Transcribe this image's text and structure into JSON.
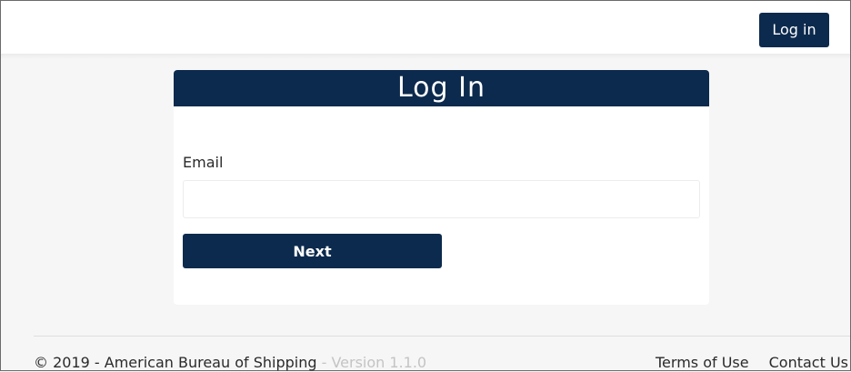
{
  "header": {
    "login_label": "Log in"
  },
  "login_card": {
    "title": "Log In",
    "email_label": "Email",
    "email_value": "",
    "next_label": "Next"
  },
  "footer": {
    "copyright": "© 2019 - American Bureau of Shipping",
    "version": " - Version 1.1.0",
    "terms_label": "Terms of Use",
    "contact_label": "Contact Us"
  },
  "colors": {
    "brand_navy": "#0c2a4d",
    "page_background": "#f6f6f6",
    "version_text": "#c4c4c4"
  }
}
